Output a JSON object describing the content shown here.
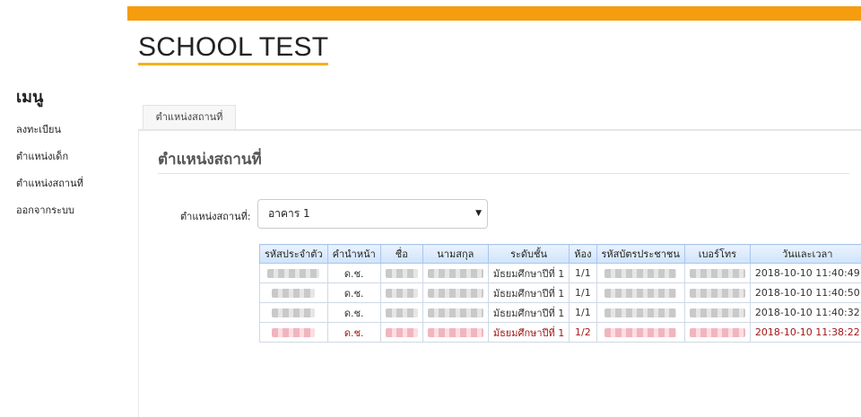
{
  "site": {
    "title": "SCHOOL TEST"
  },
  "sidebar": {
    "heading": "เมนู",
    "items": [
      {
        "label": "ลงทะเบียน"
      },
      {
        "label": "ตำแหน่งเด็ก"
      },
      {
        "label": "ตำแหน่งสถานที่"
      },
      {
        "label": "ออกจากระบบ"
      }
    ]
  },
  "tabs": [
    {
      "label": "ตำแหน่งสถานที่"
    }
  ],
  "panel": {
    "title": "ตำแหน่งสถานที่",
    "location_label": "ตำแหน่งสถานที่:",
    "location_value": "อาคาร 1"
  },
  "table": {
    "headers": [
      "รหัสประจำตัว",
      "คำนำหน้า",
      "ชื่อ",
      "นามสกุล",
      "ระดับชั้น",
      "ห้อง",
      "รหัสบัตรประชาชน",
      "เบอร์โทร",
      "วันและเวลา"
    ],
    "rows": [
      {
        "prefix": "ด.ช.",
        "level": "มัธยมศึกษาปีที่ 1",
        "room": "1/1",
        "datetime": "2018-10-10 11:40:49"
      },
      {
        "prefix": "ด.ช.",
        "level": "มัธยมศึกษาปีที่ 1",
        "room": "1/1",
        "datetime": "2018-10-10 11:40:50"
      },
      {
        "prefix": "ด.ช.",
        "level": "มัธยมศึกษาปีที่ 1",
        "room": "1/1",
        "datetime": "2018-10-10 11:40:32"
      },
      {
        "prefix": "ด.ช.",
        "level": "มัธยมศึกษาปีที่ 1",
        "room": "1/2",
        "datetime": "2018-10-10 11:38:22"
      }
    ],
    "highlight_color": "#a31515"
  },
  "colors": {
    "topbar": "#f59c0f",
    "title_underline": "#f5b21b",
    "header_bg": "#cfe3fb"
  }
}
